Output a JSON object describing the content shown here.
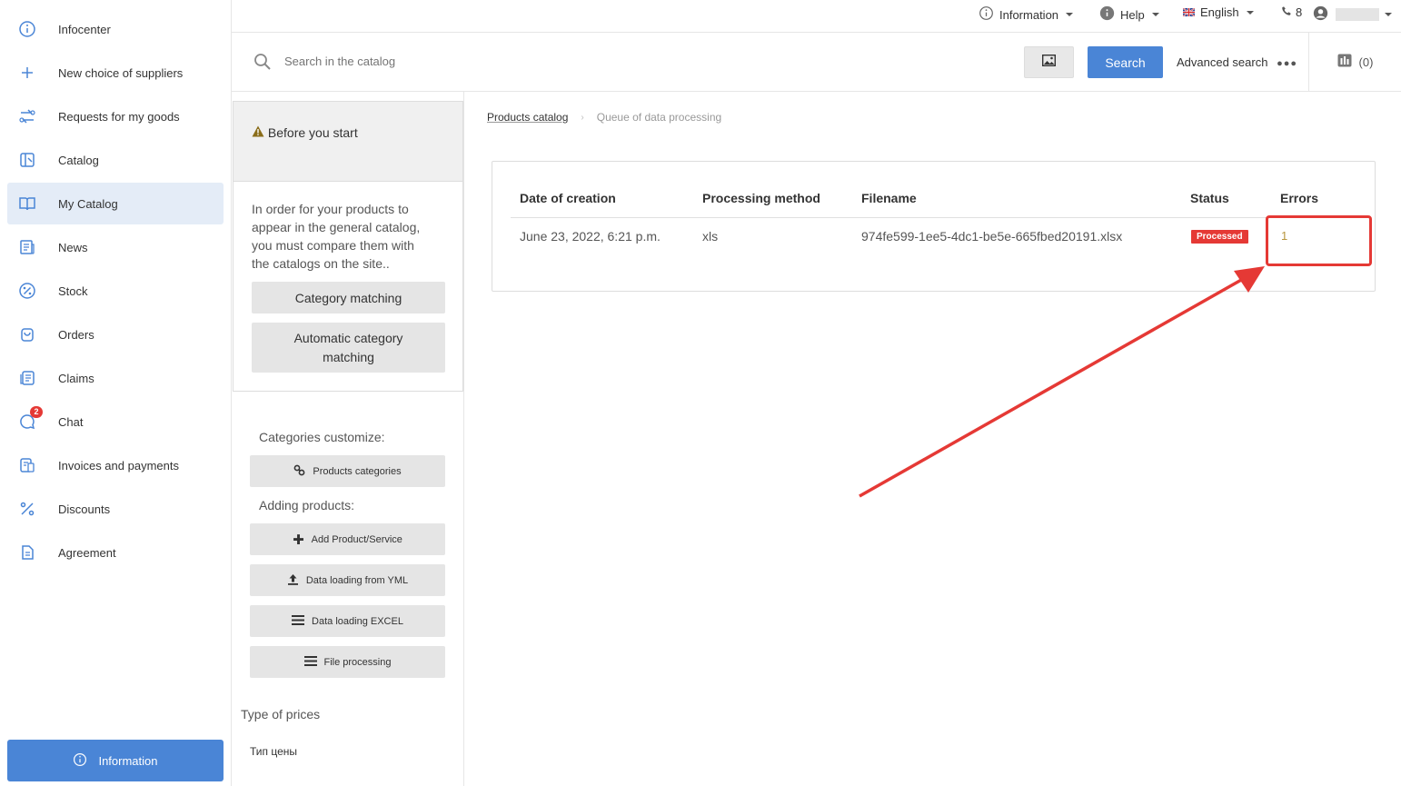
{
  "sidebar": {
    "items": [
      {
        "label": "Infocenter",
        "icon": "info-icon"
      },
      {
        "label": "New choice of suppliers",
        "icon": "plus-icon"
      },
      {
        "label": "Requests for my goods",
        "icon": "exchange-icon"
      },
      {
        "label": "Catalog",
        "icon": "catalog-icon"
      },
      {
        "label": "My Catalog",
        "icon": "book-icon"
      },
      {
        "label": "News",
        "icon": "news-icon"
      },
      {
        "label": "Stock",
        "icon": "percent-circle-icon"
      },
      {
        "label": "Orders",
        "icon": "bag-icon"
      },
      {
        "label": "Claims",
        "icon": "claims-icon"
      },
      {
        "label": "Chat",
        "icon": "chat-icon",
        "badge": "2"
      },
      {
        "label": "Invoices and payments",
        "icon": "invoice-icon"
      },
      {
        "label": "Discounts",
        "icon": "percent-icon"
      },
      {
        "label": "Agreement",
        "icon": "document-icon"
      }
    ],
    "active": "My Catalog",
    "info_button": "Information"
  },
  "topbar": {
    "information": "Information",
    "help": "Help",
    "language": "English",
    "phone_count": "8"
  },
  "search": {
    "placeholder": "Search in the catalog",
    "button": "Search",
    "advanced": "Advanced search",
    "compare": "(0)"
  },
  "panel": {
    "before_title": "Before you start",
    "before_text": "In order for your products to appear in the general catalog, you must compare them with the catalogs on the site..",
    "category_matching": "Category matching",
    "auto_category_matching": "Automatic category matching",
    "categories_customize": "Categories customize:",
    "products_categories": "Products categories",
    "adding_products": "Adding products:",
    "add_product": "Add Product/Service",
    "data_yml": "Data loading from YML",
    "data_excel": "Data loading EXCEL",
    "file_processing": "File processing",
    "type_of_prices": "Type of prices",
    "price_type_value": "Тип цены"
  },
  "breadcrumb": {
    "root": "Products catalog",
    "current": "Queue of data processing"
  },
  "table": {
    "headers": [
      "Date of creation",
      "Processing method",
      "Filename",
      "Status",
      "Errors"
    ],
    "rows": [
      {
        "date": "June 23, 2022, 6:21 p.m.",
        "method": "xls",
        "filename": "974fe599-1ee5-4dc1-be5e-665fbed20191.xlsx",
        "status": "Processed",
        "errors": "1"
      }
    ]
  },
  "colors": {
    "accent": "#4a85d6",
    "status_red": "#e53935",
    "annotation_red": "#e53935"
  }
}
